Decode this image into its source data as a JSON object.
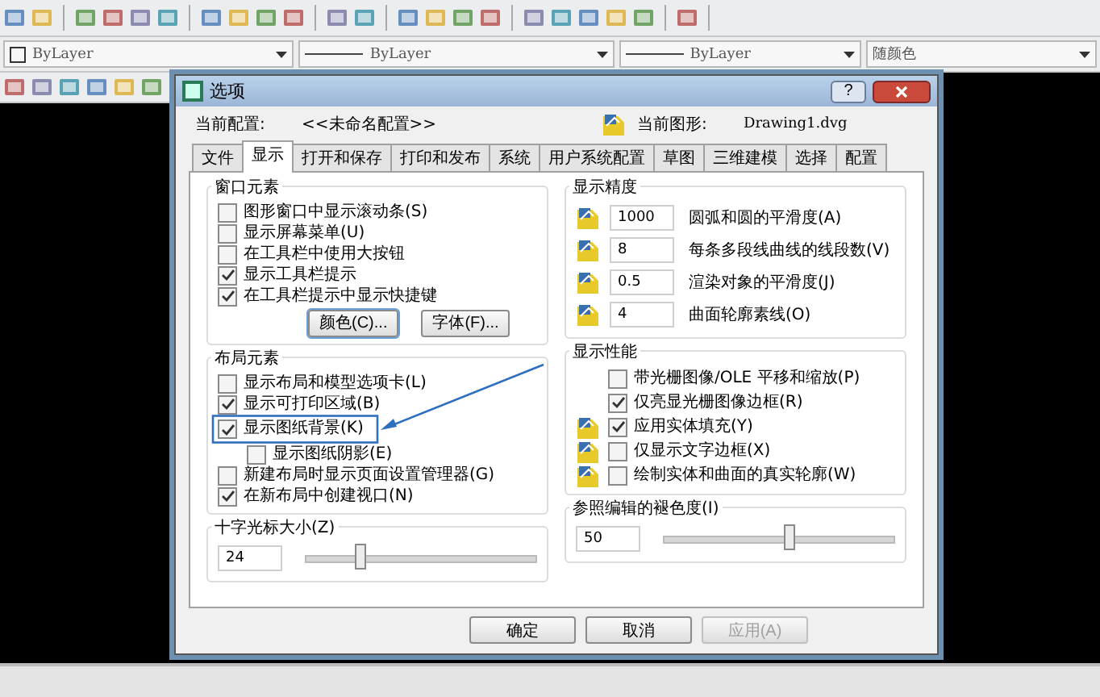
{
  "toolbar": {
    "dropdowns": [
      {
        "kind": "color",
        "text": "ByLayer"
      },
      {
        "kind": "linetype",
        "text": "ByLayer"
      },
      {
        "kind": "lineweight",
        "text": "ByLayer"
      },
      {
        "kind": "plain",
        "text": "随颜色"
      }
    ]
  },
  "dialog": {
    "title": "选项",
    "help_glyph": "?",
    "profile_label": "当前配置:",
    "profile": "<<未命名配置>>",
    "drawing_label": "当前图形:",
    "drawing": "Drawing1.dvg",
    "tabs": [
      {
        "label": "文件",
        "selected": false
      },
      {
        "label": "显示",
        "selected": true
      },
      {
        "label": "打开和保存",
        "selected": false
      },
      {
        "label": "打印和发布",
        "selected": false
      },
      {
        "label": "系统",
        "selected": false
      },
      {
        "label": "用户系统配置",
        "selected": false
      },
      {
        "label": "草图",
        "selected": false
      },
      {
        "label": "三维建模",
        "selected": false
      },
      {
        "label": "选择",
        "selected": false
      },
      {
        "label": "配置",
        "selected": false
      }
    ],
    "window_elements": {
      "title": "窗口元素",
      "options": [
        {
          "label": "图形窗口中显示滚动条(S)",
          "checked": false
        },
        {
          "label": "显示屏幕菜单(U)",
          "checked": false
        },
        {
          "label": "在工具栏中使用大按钮",
          "checked": false
        },
        {
          "label": "显示工具栏提示",
          "checked": true
        },
        {
          "label": "在工具栏提示中显示快捷键",
          "checked": true
        }
      ],
      "buttons": [
        "颜色(C)...",
        "字体(F)..."
      ]
    },
    "layout_elements": {
      "title": "布局元素",
      "options": [
        {
          "label": "显示布局和模型选项卡(L)",
          "checked": false
        },
        {
          "label": "显示可打印区域(B)",
          "checked": true
        },
        {
          "label": "显示图纸背景(K)",
          "checked": true,
          "children": [
            {
              "label": "显示图纸阴影(E)",
              "checked": false
            }
          ]
        },
        {
          "label": "新建布局时显示页面设置管理器(G)",
          "checked": false
        },
        {
          "label": "在新布局中创建视口(N)",
          "checked": true
        }
      ]
    },
    "crosshair": {
      "title": "十字光标大小(Z)",
      "value": "24",
      "level": 0.24
    },
    "display_resolution": {
      "title": "显示精度",
      "rows": [
        {
          "value": "1000",
          "label": "圆弧和圆的平滑度(A)"
        },
        {
          "value": "8",
          "label": "每条多段线曲线的线段数(V)"
        },
        {
          "value": "0.5",
          "label": "渲染对象的平滑度(J)"
        },
        {
          "value": "4",
          "label": "曲面轮廓素线(O)"
        }
      ]
    },
    "display_performance": {
      "title": "显示性能",
      "options": [
        {
          "kind": "plain",
          "label": "带光栅图像/OLE 平移和缩放(P)",
          "checked": false
        },
        {
          "kind": "plain",
          "label": "仅亮显光栅图像边框(R)",
          "checked": true
        },
        {
          "kind": "saved",
          "label": "应用实体填充(Y)",
          "checked": true
        },
        {
          "kind": "saved",
          "label": "仅显示文字边框(X)",
          "checked": false
        },
        {
          "kind": "saved",
          "label": "绘制实体和曲面的真实轮廓(W)",
          "checked": false
        }
      ]
    },
    "fade": {
      "title": "参照编辑的褪色度(I)",
      "value": "50",
      "level": 0.55
    },
    "buttons": [
      {
        "label": "确定",
        "disabled": false
      },
      {
        "label": "取消",
        "disabled": false
      },
      {
        "label": "应用(A)",
        "disabled": true
      }
    ]
  }
}
